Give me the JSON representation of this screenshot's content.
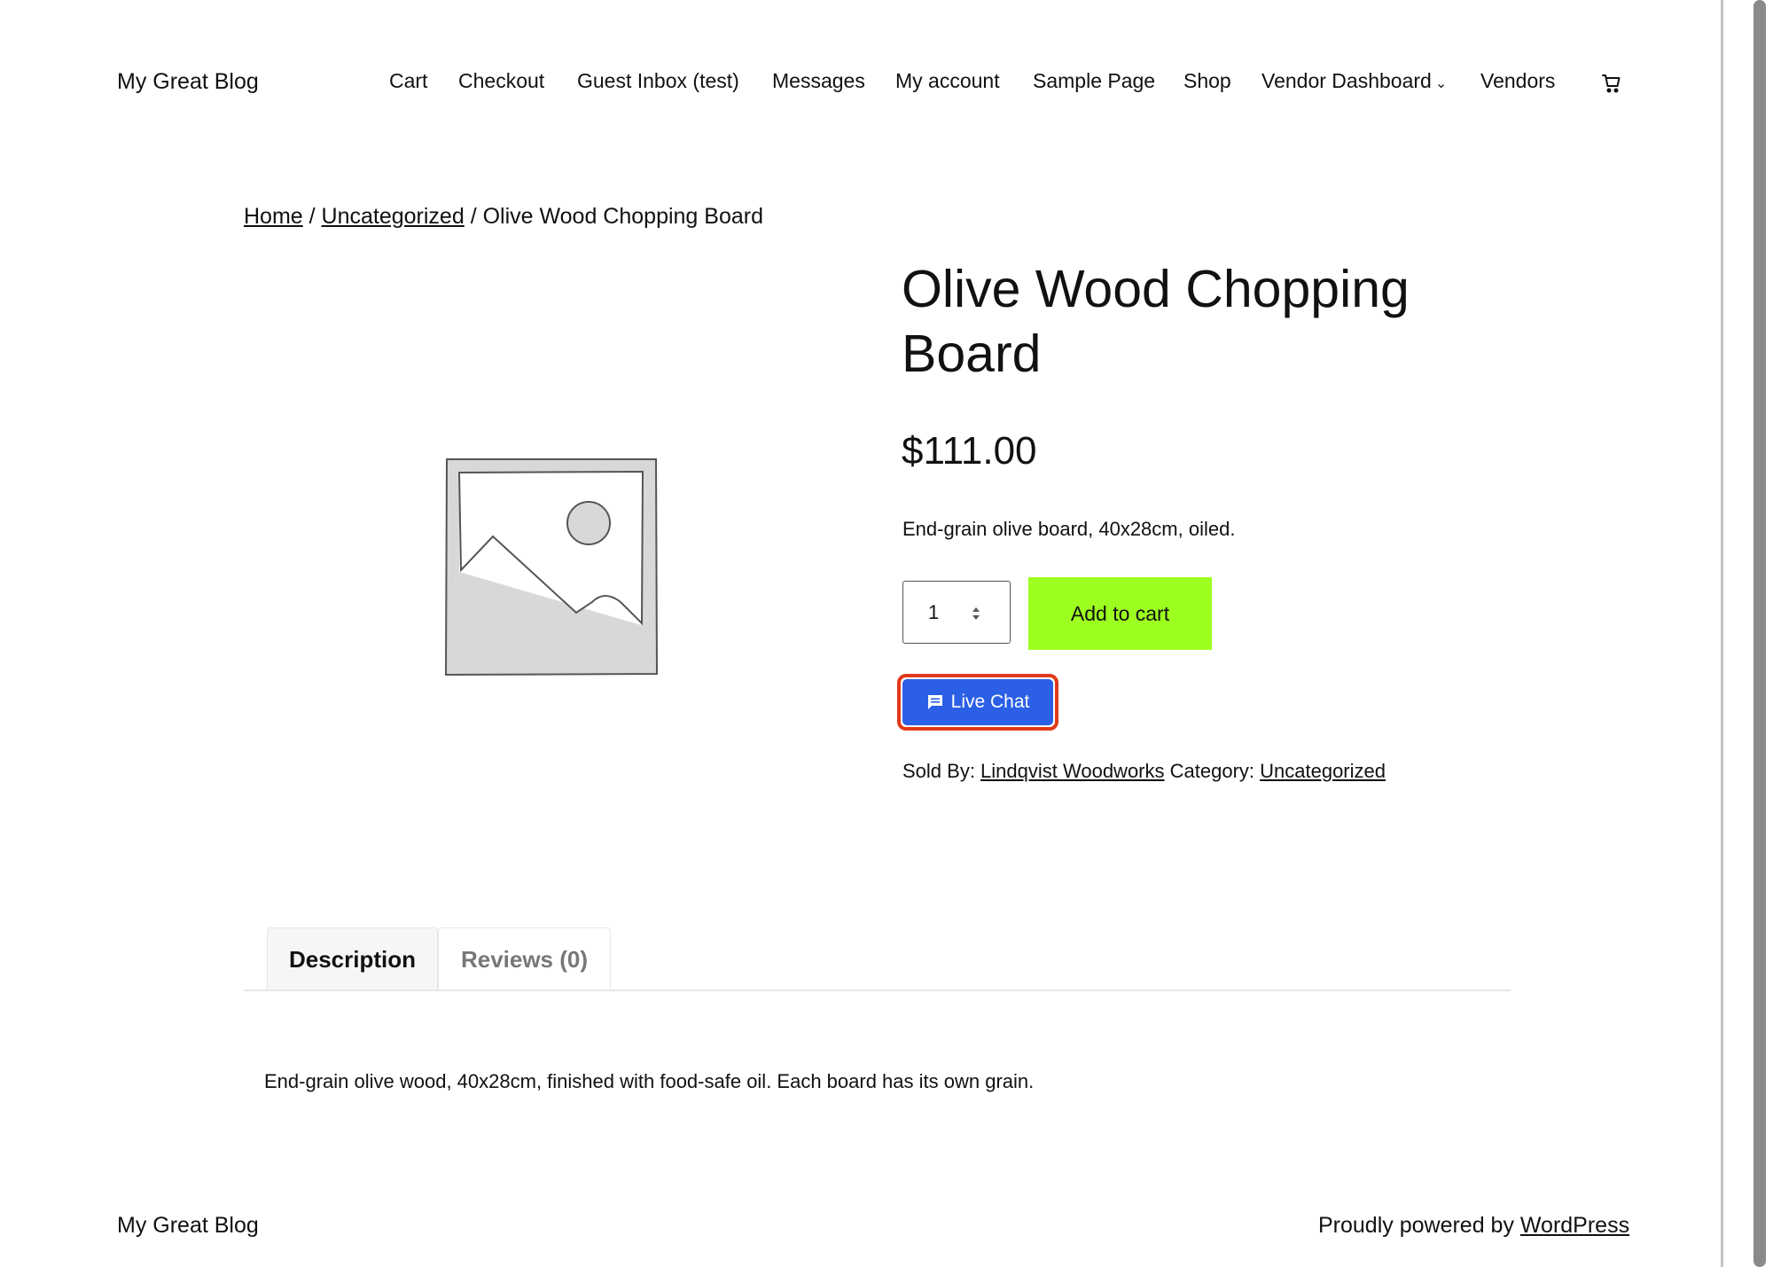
{
  "site": {
    "title": "My Great Blog"
  },
  "nav": {
    "items": [
      {
        "label": "Cart"
      },
      {
        "label": "Checkout"
      },
      {
        "label": "Guest Inbox (test)"
      },
      {
        "label": "Messages"
      },
      {
        "label": "My account"
      },
      {
        "label": "Sample Page"
      },
      {
        "label": "Shop"
      },
      {
        "label": "Vendor Dashboard"
      },
      {
        "label": "Vendors"
      }
    ],
    "cart_icon": "cart-icon"
  },
  "breadcrumb": {
    "home": "Home",
    "sep1": " / ",
    "category": "Uncategorized",
    "sep2": " / ",
    "current": "Olive Wood Chopping Board"
  },
  "product": {
    "image_icon": "image-placeholder-icon",
    "title": "Olive Wood Chopping Board",
    "price": "$111.00",
    "short_description": "End-grain olive board, 40x28cm, oiled.",
    "quantity": "1",
    "add_to_cart_label": "Add to cart",
    "live_chat_label": "Live Chat",
    "sold_by_label": "Sold By: ",
    "vendor": "Lindqvist Woodworks",
    "category_label": " Category: ",
    "category": "Uncategorized"
  },
  "tabs": {
    "description": "Description",
    "reviews": "Reviews (0)"
  },
  "description_text": "End-grain olive wood, 40x28cm, finished with food-safe oil. Each board has its own grain.",
  "footer": {
    "title": "My Great Blog",
    "powered_prefix": "Proudly powered by ",
    "powered_link": "WordPress"
  },
  "colors": {
    "add_to_cart_bg": "#9dff20",
    "live_chat_bg": "#2a5fe6",
    "highlight_outline": "#e03a1a"
  }
}
